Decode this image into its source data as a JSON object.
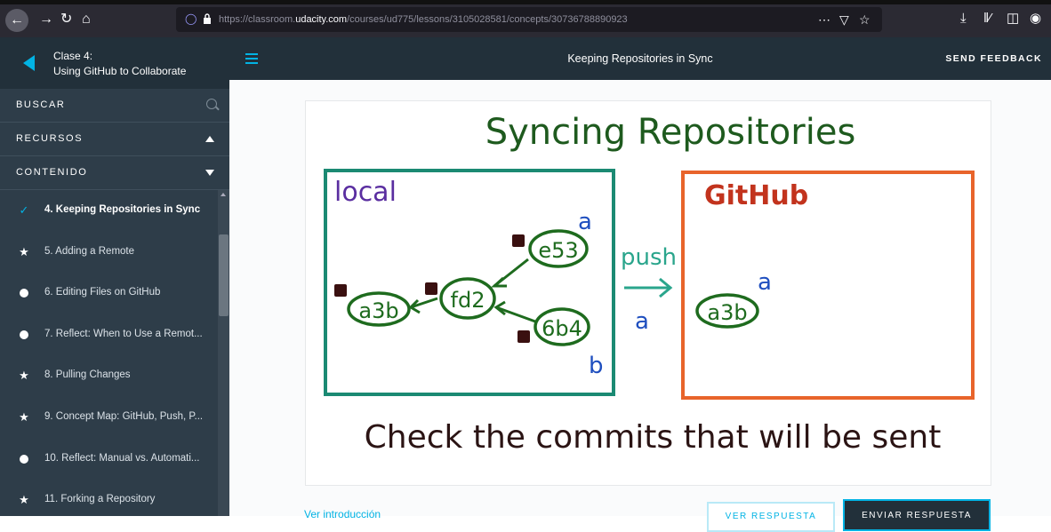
{
  "browser": {
    "url_prefix": "https://classroom.",
    "url_domain": "udacity.com",
    "url_path": "/courses/ud775/lessons/3105028581/concepts/30736788890923",
    "icons": [
      "back-arrow-icon",
      "forward-arrow-icon",
      "reload-icon",
      "home-icon",
      "shield-icon",
      "lock-icon",
      "more-icon",
      "pocket-icon",
      "star-icon",
      "download-icon",
      "library-icon",
      "sidebar-toggle-icon",
      "account-icon"
    ]
  },
  "sidebar": {
    "lesson_number": "Clase 4:",
    "lesson_title": "Using GitHub to Collaborate",
    "search_label": "BUSCAR",
    "resources_label": "RECURSOS",
    "content_label": "CONTENIDO",
    "concepts": [
      {
        "label": "4. Keeping Repositories in Sync",
        "icon": "check",
        "active": true
      },
      {
        "label": "5. Adding a Remote",
        "icon": "star",
        "active": false
      },
      {
        "label": "6. Editing Files on GitHub",
        "icon": "dot",
        "active": false
      },
      {
        "label": "7. Reflect: When to Use a Remot...",
        "icon": "dot",
        "active": false
      },
      {
        "label": "8. Pulling Changes",
        "icon": "star",
        "active": false
      },
      {
        "label": "9. Concept Map: GitHub, Push, P...",
        "icon": "star",
        "active": false
      },
      {
        "label": "10. Reflect: Manual vs. Automati...",
        "icon": "dot",
        "active": false
      },
      {
        "label": "11. Forking a Repository",
        "icon": "star",
        "active": false
      }
    ]
  },
  "header": {
    "title": "Keeping Repositories in Sync",
    "feedback_label": "SEND FEEDBACK"
  },
  "sketch": {
    "title": "Syncing Repositories",
    "local_label": "local",
    "github_label": "GitHub",
    "commits": [
      "a3b",
      "fd2",
      "e53",
      "6b4"
    ],
    "github_commit": "a3b",
    "branch_a": "a",
    "branch_b": "b",
    "push_label": "push",
    "push_branch": "a",
    "caption": "Check the commits that will be sent",
    "colors": {
      "local_box": "#1b8a73",
      "github_box": "#e8642b",
      "commit": "#1e6b1e",
      "branch": "#1f4fbf",
      "push": "#2aa58c",
      "text": "#2b1414"
    }
  },
  "footer": {
    "intro_link": "Ver introducción",
    "show_answer": "VER RESPUESTA",
    "submit_answer": "ENVIAR RESPUESTA"
  }
}
